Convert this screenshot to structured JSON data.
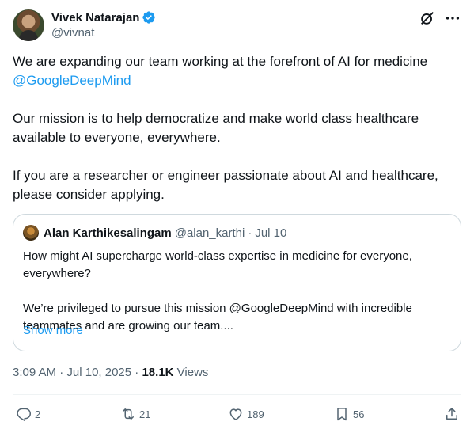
{
  "author": {
    "name": "Vivek Natarajan",
    "handle": "@vivnat"
  },
  "tweet": {
    "line1": "We are expanding our team working at the forefront of AI for medicine",
    "mention": "@GoogleDeepMind",
    "para2": "Our mission is to help democratize and make world class healthcare available to everyone, everywhere.",
    "para3": "If you are a researcher or engineer passionate about AI and healthcare, please consider applying."
  },
  "quote": {
    "name": "Alan Karthikesalingam",
    "handle": "@alan_karthi",
    "separator": "·",
    "date": "Jul 10",
    "para1": "How might AI supercharge world-class expertise in medicine for everyone, everywhere?",
    "para2": "We’re privileged to pursue this mission @GoogleDeepMind with incredible teammates and are growing our team....",
    "show_more": "Show more"
  },
  "meta": {
    "time": "3:09 AM",
    "dot1": "·",
    "date": "Jul 10, 2025",
    "dot2": "·",
    "views_count": "18.1K",
    "views_label": "Views"
  },
  "actions": {
    "replies": "2",
    "reposts": "21",
    "likes": "189",
    "bookmarks": "56"
  },
  "colors": {
    "accent": "#1d9bf0",
    "text": "#0f1419",
    "secondary": "#536471",
    "border": "#cfd9de"
  },
  "icons": [
    "verified-badge-icon",
    "grok-icon",
    "more-icon",
    "reply-icon",
    "repost-icon",
    "like-icon",
    "bookmark-icon",
    "share-icon"
  ]
}
